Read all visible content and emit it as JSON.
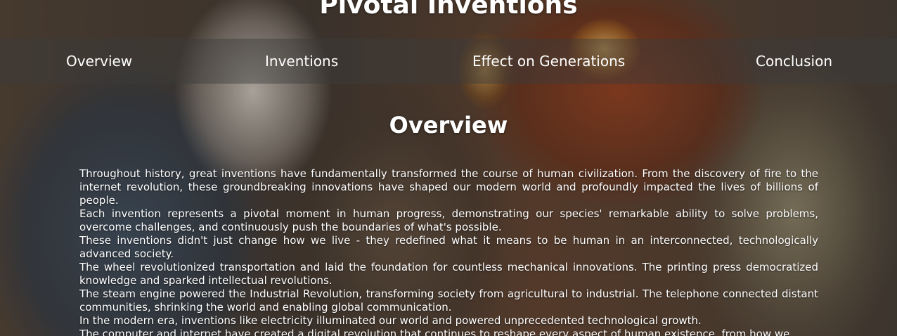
{
  "site": {
    "title": "Pivotal Inventions"
  },
  "nav": {
    "items": [
      {
        "label": "Overview"
      },
      {
        "label": "Inventions"
      },
      {
        "label": "Effect on Generations"
      },
      {
        "label": "Conclusion"
      }
    ]
  },
  "main": {
    "heading": "Overview",
    "paragraphs": [
      "Throughout history, great inventions have fundamentally transformed the course of human civilization. From the discovery of fire to the internet revolution, these groundbreaking innovations have shaped our modern world and profoundly impacted the lives of billions of people.",
      "Each invention represents a pivotal moment in human progress, demonstrating our species' remarkable ability to solve problems, overcome challenges, and continuously push the boundaries of what's possible.",
      "These inventions didn't just change how we live - they redefined what it means to be human in an interconnected, technologically advanced society.",
      "The wheel revolutionized transportation and laid the foundation for countless mechanical innovations. The printing press democratized knowledge and sparked intellectual revolutions.",
      "The steam engine powered the Industrial Revolution, transforming society from agricultural to industrial. The telephone connected distant communities, shrinking the world and enabling global communication.",
      "In the modern era, inventions like electricity illuminated our world and powered unprecedented technological growth.",
      "The computer and internet have created a digital revolution that continues to reshape every aspect of human existence, from how we"
    ]
  }
}
